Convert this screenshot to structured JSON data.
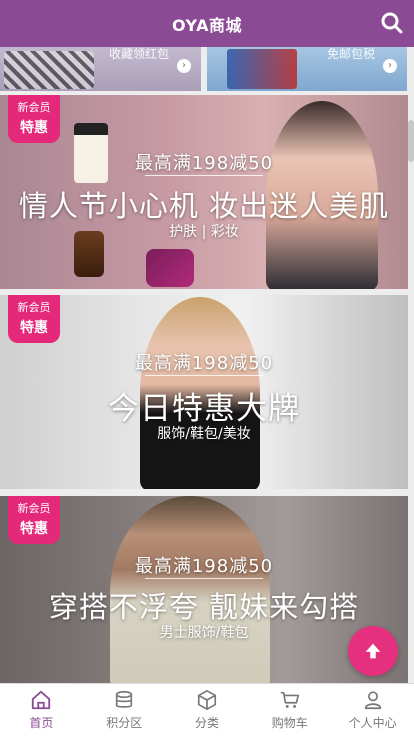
{
  "header": {
    "title": "OYA商城"
  },
  "top_cards": [
    {
      "label": "收藏领红包"
    },
    {
      "label": "免邮包税"
    }
  ],
  "banners": [
    {
      "badge_top": "新会员",
      "badge_bottom": "特惠",
      "promo": "最高满198减50",
      "headline": "情人节小心机 妆出迷人美肌",
      "sub": "护肤 | 彩妆"
    },
    {
      "badge_top": "新会员",
      "badge_bottom": "特惠",
      "promo": "最高满198减50",
      "headline": "今日特惠大牌",
      "sub": "服饰/鞋包/美妆"
    },
    {
      "badge_top": "新会员",
      "badge_bottom": "特惠",
      "promo": "最高满198减50",
      "headline": "穿搭不浮夸 靓妹来勾搭",
      "sub": "男士服饰/鞋包"
    }
  ],
  "tabbar": [
    {
      "label": "首页",
      "icon": "home-icon",
      "active": true
    },
    {
      "label": "积分区",
      "icon": "coins-icon",
      "active": false
    },
    {
      "label": "分类",
      "icon": "cube-icon",
      "active": false
    },
    {
      "label": "购物车",
      "icon": "cart-icon",
      "active": false
    },
    {
      "label": "个人中心",
      "icon": "user-icon",
      "active": false
    }
  ],
  "colors": {
    "brand": "#8a4a94",
    "accent": "#e4297b"
  }
}
